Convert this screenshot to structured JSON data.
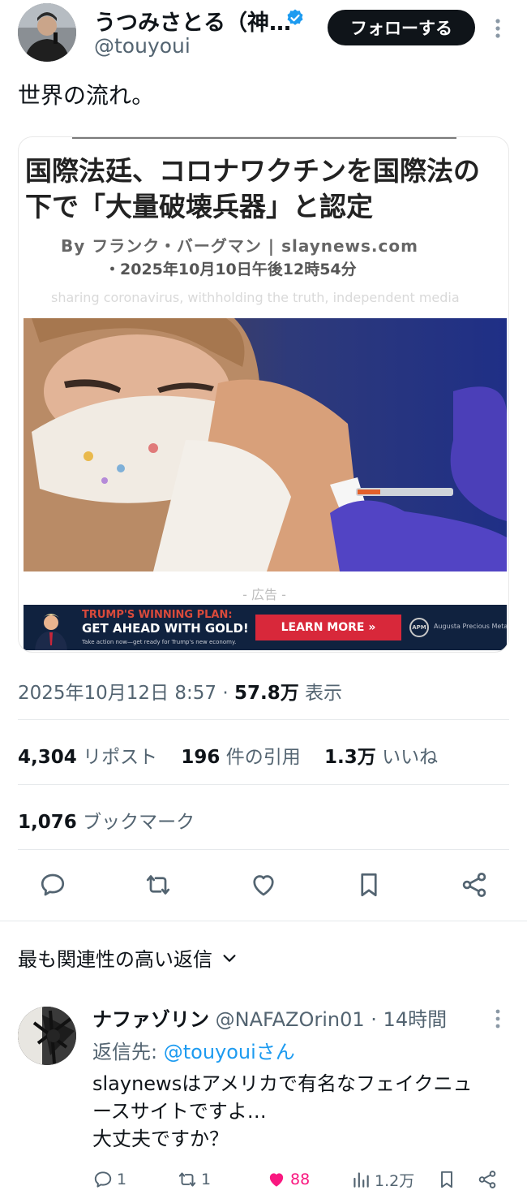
{
  "tweet": {
    "author": {
      "display_name": "うつみさとる（神…",
      "handle": "@touyoui",
      "verified_icon": "verified-badge-icon"
    },
    "follow_label": "フォローする",
    "text": "世界の流れ。",
    "media": {
      "title": "国際法廷、コロナワクチンを国際法の下で「大量破壊兵器」と認定",
      "byline": "By フランク・バーグマン | slaynews.com",
      "date": "・2025年10月10日午後12時54分",
      "faint_line": "sharing coronavirus, withholding the truth, independent media",
      "ad_label": "- 広告 -",
      "ad": {
        "headline1": "TRUMP'S WINNING PLAN:",
        "headline2": "GET AHEAD WITH GOLD!",
        "subline": "Take action now—get ready for Trump's new economy.",
        "cta": "LEARN MORE »",
        "logo_mark": "APM",
        "logo_text": "Augusta Precious Metals"
      }
    },
    "timestamp": "2025年10月12日 8:57",
    "separator": " · ",
    "views_value": "57.8万",
    "views_label": " 表示",
    "stats": {
      "reposts_value": "4,304",
      "reposts_label": "リポスト",
      "quotes_value": "196",
      "quotes_label": "件の引用",
      "likes_value": "1.3万",
      "likes_label": "いいね",
      "bookmarks_value": "1,076",
      "bookmarks_label": "ブックマーク"
    },
    "actions": [
      "reply-icon",
      "repost-icon",
      "like-icon",
      "bookmark-icon",
      "share-icon"
    ]
  },
  "replies_sort_label": "最も関連性の高い返信",
  "reply": {
    "display_name": "ナファゾリン",
    "handle": "@NAFAZOrin01",
    "time": "14時間",
    "reply_to_prefix": "返信先: ",
    "reply_to_handle": "@touyouiさん",
    "text_lines": [
      "slaynewsはアメリカで有名なフェイクニュ",
      "ースサイトですよ…",
      "大丈夫ですか？"
    ],
    "counts": {
      "replies": "1",
      "reposts": "1",
      "likes": "88",
      "views": "1.2万"
    }
  },
  "colors": {
    "text_primary": "#0f1419",
    "text_secondary": "#536471",
    "link_blue": "#1d9bf0",
    "like_pink": "#f91880",
    "follow_button": "#0f1419"
  }
}
